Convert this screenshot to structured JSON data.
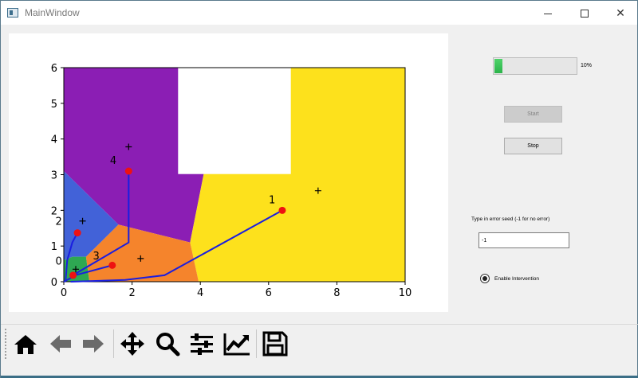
{
  "window": {
    "title": "MainWindow",
    "minimize_label": "",
    "maximize_label": "",
    "close_label": "✕"
  },
  "chart_data": {
    "type": "scatter",
    "xlim": [
      0,
      10
    ],
    "ylim": [
      0,
      6
    ],
    "xticks": [
      "0",
      "2",
      "4",
      "6",
      "8",
      "10"
    ],
    "yticks": [
      "0",
      "1",
      "2",
      "3",
      "4",
      "5",
      "6"
    ],
    "regions": [
      {
        "color": "#8b1eb4",
        "polygon": [
          [
            0,
            6
          ],
          [
            3.35,
            6
          ],
          [
            3.35,
            3.02
          ],
          [
            4.1,
            3.02
          ],
          [
            3.7,
            1.1
          ],
          [
            1.6,
            1.6
          ],
          [
            0,
            3.1
          ]
        ]
      },
      {
        "color": "#fde11c",
        "polygon": [
          [
            4.1,
            3.02
          ],
          [
            6.65,
            3.02
          ],
          [
            6.65,
            6
          ],
          [
            10,
            6
          ],
          [
            10,
            0
          ],
          [
            3.95,
            0
          ],
          [
            3.7,
            1.1
          ]
        ]
      },
      {
        "color": "#ffffff",
        "polygon": [
          [
            3.35,
            6
          ],
          [
            6.65,
            6
          ],
          [
            6.65,
            3.02
          ],
          [
            3.35,
            3.02
          ]
        ]
      },
      {
        "color": "#f5842c",
        "polygon": [
          [
            1.6,
            1.6
          ],
          [
            3.7,
            1.1
          ],
          [
            3.95,
            0
          ],
          [
            0.75,
            0
          ],
          [
            0.65,
            0.7
          ]
        ]
      },
      {
        "color": "#4262d8",
        "polygon": [
          [
            0,
            3.1
          ],
          [
            1.6,
            1.6
          ],
          [
            0.65,
            0.7
          ],
          [
            0.25,
            0.7
          ],
          [
            0,
            0.6
          ]
        ]
      },
      {
        "color": "#2ea852",
        "polygon": [
          [
            0,
            0.6
          ],
          [
            0.25,
            0.7
          ],
          [
            0.65,
            0.7
          ],
          [
            0.75,
            0
          ],
          [
            0,
            0
          ]
        ]
      }
    ],
    "centroids": [
      [
        0.35,
        0.35
      ],
      [
        7.45,
        2.55
      ],
      [
        0.55,
        1.7
      ],
      [
        2.25,
        0.65
      ],
      [
        1.9,
        3.78
      ]
    ],
    "agents": [
      {
        "id": "0",
        "pos": [
          0.27,
          0.18
        ],
        "path": [
          [
            0,
            0
          ],
          [
            0.2,
            0.1
          ],
          [
            0.27,
            0.18
          ]
        ]
      },
      {
        "id": "1",
        "pos": [
          6.4,
          2.0
        ],
        "path": [
          [
            0.2,
            0
          ],
          [
            1.8,
            0.05
          ],
          [
            2.95,
            0.18
          ],
          [
            6.4,
            2.0
          ]
        ]
      },
      {
        "id": "2",
        "pos": [
          0.4,
          1.37
        ],
        "path": [
          [
            0.05,
            0
          ],
          [
            0.1,
            0.6
          ],
          [
            0.25,
            1.1
          ],
          [
            0.4,
            1.37
          ]
        ]
      },
      {
        "id": "3",
        "pos": [
          1.42,
          0.46
        ],
        "path": [
          [
            0.2,
            0.15
          ],
          [
            0.6,
            0.25
          ],
          [
            1.42,
            0.46
          ]
        ]
      },
      {
        "id": "4",
        "pos": [
          1.9,
          3.1
        ],
        "path": [
          [
            0.3,
            0.2
          ],
          [
            1.9,
            1.1
          ],
          [
            1.9,
            2.9
          ],
          [
            1.9,
            3.1
          ]
        ]
      }
    ],
    "label_positions": [
      [
        -0.15,
        0.48
      ],
      [
        6.1,
        2.2
      ],
      [
        -0.15,
        1.6
      ],
      [
        0.95,
        0.62
      ],
      [
        1.45,
        3.3
      ]
    ],
    "grid": false
  },
  "controls": {
    "progress_value": 0.1,
    "progress_text": "10%",
    "start_label": "Start",
    "stop_label": "Stop",
    "seed_label": "Type in error seed (-1 for no error)",
    "seed_value": "-1",
    "intervention_label": "Enable Intervention"
  },
  "toolbar": {
    "home": "home-icon",
    "back": "back-arrow-icon",
    "forward": "forward-arrow-icon",
    "pan": "move-icon",
    "zoom": "zoom-icon",
    "configure": "sliders-icon",
    "edit": "chart-line-icon",
    "save": "save-icon"
  },
  "colors": {
    "path": "#1a1ee0",
    "agent": "#ee1111",
    "progress": "#2bb34a"
  }
}
